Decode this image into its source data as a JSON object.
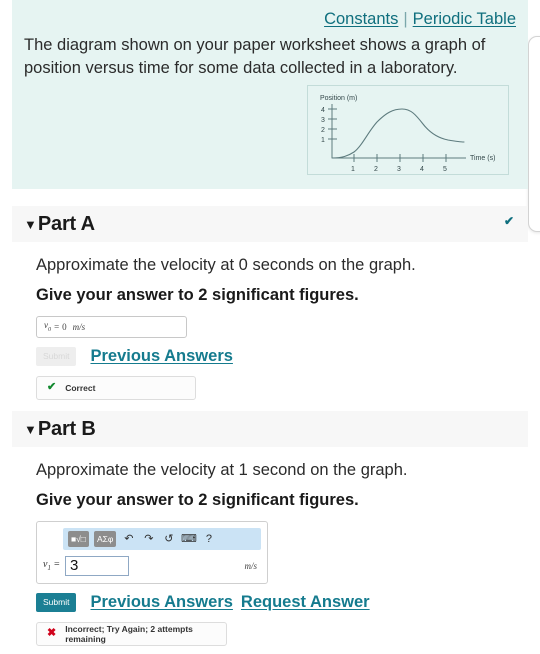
{
  "tools": {
    "constants_label": "Constants",
    "separator": "|",
    "periodic_table_label": "Periodic Table"
  },
  "problem": {
    "statement": "The diagram shown on your paper worksheet shows a graph of position versus time for some data collected in a laboratory."
  },
  "figure": {
    "y_axis_label": "Position (m)",
    "x_axis_label": "Time (s)",
    "y_ticks": [
      "4",
      "3",
      "2",
      "1"
    ],
    "x_ticks": [
      "1",
      "2",
      "3",
      "4",
      "5"
    ]
  },
  "parts": [
    {
      "caret": "▼",
      "title": "Part A",
      "status_check": "✔",
      "question": "Approximate the velocity at 0 seconds on the graph.",
      "instruction": "Give your answer to 2 significant figures.",
      "answer": {
        "symbol": "v",
        "subscript": "0",
        "equals": "=",
        "value": "0",
        "units": "m/s"
      },
      "submit_label": "Submit",
      "links": [
        "Previous Answers"
      ],
      "feedback": {
        "icon": "✔",
        "text": "Correct"
      }
    },
    {
      "caret": "▼",
      "title": "Part B",
      "question": "Approximate the velocity at 1 second on the graph.",
      "instruction": "Give your answer to 2 significant figures.",
      "answer": {
        "symbol": "v",
        "subscript": "1",
        "equals": "=",
        "value": "3",
        "units": "m/s"
      },
      "toolbar": {
        "template_button": "■√□",
        "greek_button": "ΑΣφ",
        "undo": "↶",
        "redo": "↷",
        "reset": "↺",
        "keyboard": "⌨",
        "help": "?"
      },
      "submit_label": "Submit",
      "links": [
        "Previous Answers",
        "Request Answer"
      ],
      "feedback": {
        "icon": "✖",
        "text": "Incorrect; Try Again; 2 attempts remaining"
      }
    }
  ],
  "colors": {
    "problem_bg": "#e6f4f2",
    "link": "#157b8e",
    "submit_active": "#1b7f94",
    "correct": "#12892f",
    "incorrect": "#d0021b",
    "toolbar_bg": "#cbe3f5"
  }
}
